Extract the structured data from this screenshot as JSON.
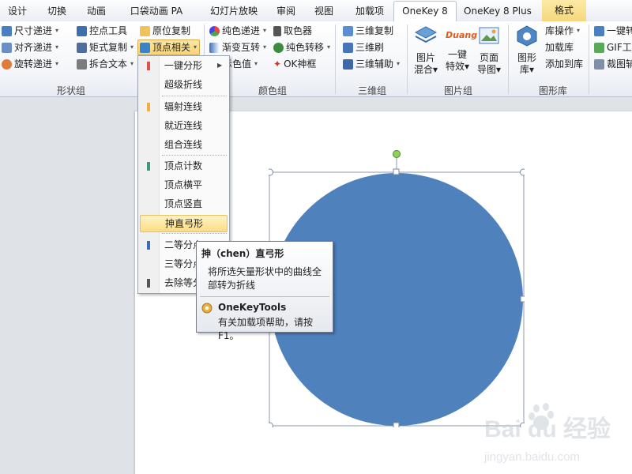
{
  "tabs": [
    "设计",
    "切换",
    "动画",
    "口袋动画 PA",
    "幻灯片放映",
    "审阅",
    "视图",
    "加载项",
    "OneKey 8",
    "OneKey 8 Plus",
    "格式"
  ],
  "active_tab": "OneKey 8",
  "ribbon": {
    "shape_group": {
      "label": "形状组",
      "buttons": [
        "尺寸递进",
        "对齐递进",
        "旋转递进",
        "控点工具",
        "矩式复制",
        "拆合文本",
        "原位复制",
        "顶点相关"
      ]
    },
    "color_group": {
      "label": "颜色组",
      "buttons": [
        "纯色递进",
        "渐变互转",
        "显示色值",
        "取色器",
        "纯色转移",
        "OK神框"
      ]
    },
    "threed_group": {
      "label": "三维组",
      "buttons": [
        "三维复制",
        "三维刷",
        "三维辅助"
      ]
    },
    "image_group": {
      "label": "图片组",
      "buttons": [
        {
          "line1": "图片",
          "line2": "混合"
        },
        {
          "line1": "一键",
          "line2": "特效"
        },
        {
          "line1": "页面",
          "line2": "导图"
        }
      ],
      "duang_text": "Duang"
    },
    "library_group": {
      "label": "图形库",
      "big_button": {
        "line1": "图形",
        "line2": "库"
      },
      "buttons": [
        "库操作",
        "加载库",
        "添加到库"
      ]
    },
    "extra": [
      "一键转",
      "GIF工",
      "裁图辅"
    ]
  },
  "menu": {
    "items": [
      {
        "label": "一键分形",
        "marker": "#d9534f",
        "submenu": true
      },
      {
        "label": "超级折线",
        "marker": ""
      },
      {
        "label": "辐射连线",
        "marker": "#f0ad4e"
      },
      {
        "label": "就近连线",
        "marker": ""
      },
      {
        "label": "组合连线",
        "marker": ""
      },
      {
        "label": "顶点计数",
        "marker": "#3c9a7a"
      },
      {
        "label": "顶点横平",
        "marker": ""
      },
      {
        "label": "顶点竖直",
        "marker": ""
      },
      {
        "label": "抻直弓形",
        "marker": "",
        "highlight": true
      },
      {
        "label": "二等分点",
        "marker": "#3a6fb0"
      },
      {
        "label": "三等分点",
        "marker": ""
      },
      {
        "label": "去除等分",
        "marker": "#555555"
      }
    ]
  },
  "tooltip": {
    "title": "抻（chen）直弓形",
    "description": "将所选矢量形状中的曲线全部转为折线",
    "addin_name": "OneKeyTools",
    "help": "有关加载项帮助，请按 F1。"
  },
  "shape": {
    "fill": "#4f81bd"
  },
  "watermark": {
    "brand": "Bai du 经验",
    "url": "jingyan.baidu.com"
  }
}
